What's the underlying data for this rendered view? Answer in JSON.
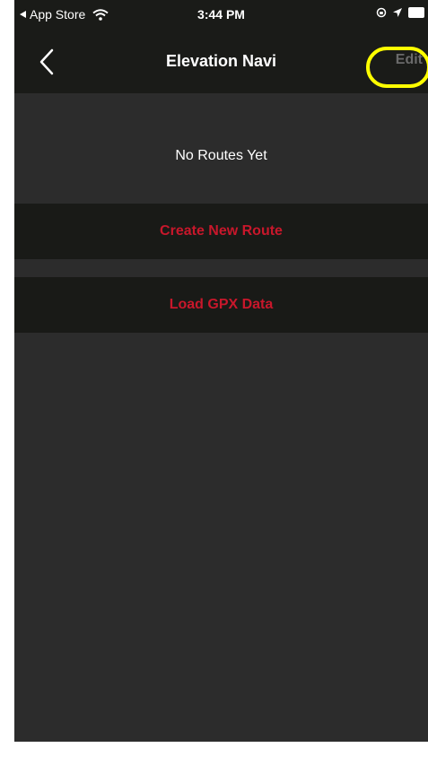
{
  "status_bar": {
    "back_app": "App Store",
    "time": "3:44 PM",
    "wifi_icon": "wifi-icon",
    "location_icon": "location-arrow-icon",
    "rotation_lock_icon": "rotation-lock-icon",
    "battery_icon": "battery-icon"
  },
  "nav": {
    "title": "Elevation Navi",
    "back_icon": "chevron-left-icon",
    "edit_label": "Edit"
  },
  "content": {
    "empty_label": "No Routes Yet",
    "create_route_label": "Create New Route",
    "load_gpx_label": "Load GPX Data"
  },
  "colors": {
    "background": "#2c2c2c",
    "bar": "#1a1b18",
    "accent": "#c8172b",
    "highlight": "#ffff00"
  }
}
